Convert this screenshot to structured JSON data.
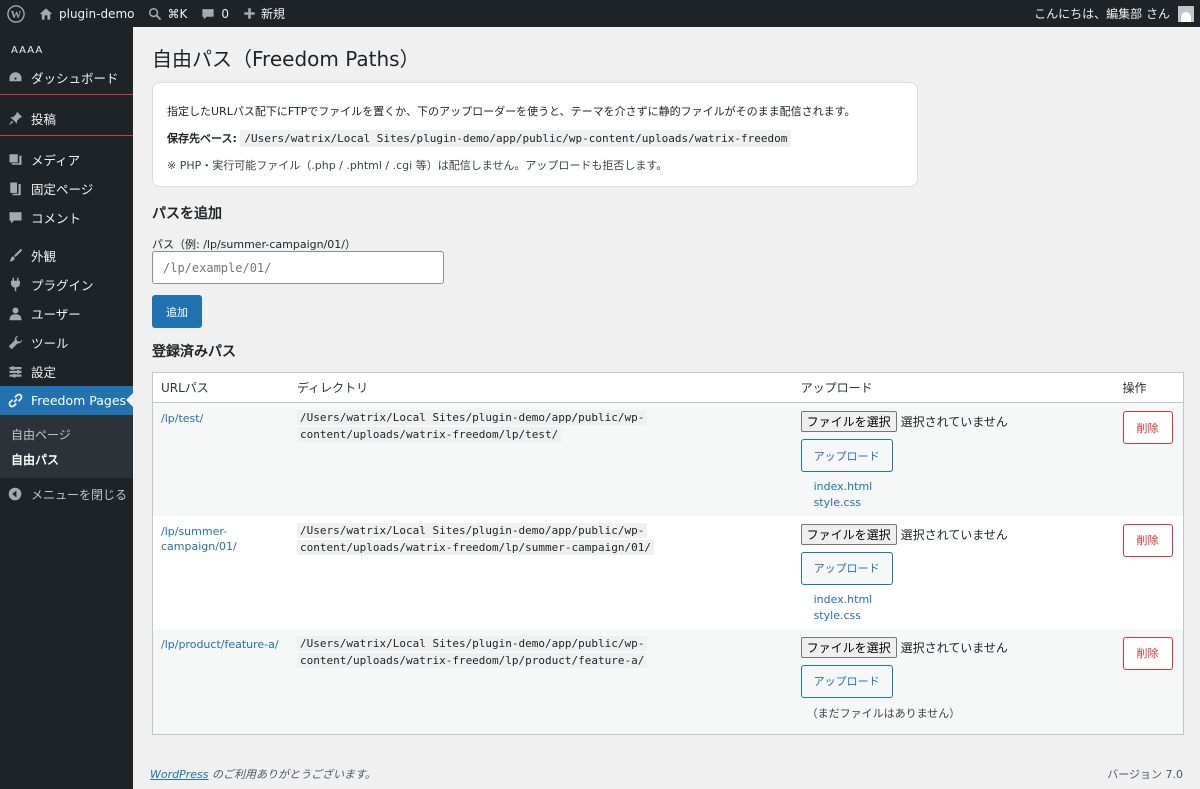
{
  "adminbar": {
    "site_name": "plugin-demo",
    "shortcut": "⌘K",
    "comments_count": "0",
    "new_label": "新規",
    "greeting": "こんにちは、編集部 さん"
  },
  "sidebar": {
    "site_title": "AAAA",
    "items": [
      {
        "label": "ダッシュボード",
        "icon": "dashboard-icon"
      },
      {
        "label": "投稿",
        "icon": "pin-icon"
      },
      {
        "label": "メディア",
        "icon": "media-icon"
      },
      {
        "label": "固定ページ",
        "icon": "page-icon"
      },
      {
        "label": "コメント",
        "icon": "comment-icon"
      },
      {
        "label": "外観",
        "icon": "brush-icon"
      },
      {
        "label": "プラグイン",
        "icon": "plugin-icon"
      },
      {
        "label": "ユーザー",
        "icon": "user-icon"
      },
      {
        "label": "ツール",
        "icon": "wrench-icon"
      },
      {
        "label": "設定",
        "icon": "settings-icon"
      },
      {
        "label": "Freedom Pages",
        "icon": "link-icon"
      }
    ],
    "submenu": [
      "自由ページ",
      "自由パス"
    ],
    "collapse_label": "メニューを閉じる"
  },
  "page": {
    "title": "自由パス（Freedom Paths）",
    "notice": {
      "description": "指定したURLパス配下にFTPでファイルを置くか、下のアップローダーを使うと、テーマを介さずに静的ファイルがそのまま配信されます。",
      "base_label": "保存先ベース:",
      "base_path": "/Users/watrix/Local Sites/plugin-demo/app/public/wp-content/uploads/watrix-freedom",
      "warning": "※ PHP・実行可能ファイル（.php / .phtml / .cgi 等）は配信しません。アップロードも拒否します。"
    },
    "add_section": {
      "heading": "パスを追加",
      "field_label": "パス（例: /lp/summer-campaign/01/）",
      "placeholder": "/lp/example/01/",
      "button": "追加"
    },
    "registered": {
      "heading": "登録済みパス",
      "columns": [
        "URLパス",
        "ディレクトリ",
        "アップロード",
        "操作"
      ],
      "file_button": "ファイルを選択",
      "file_status": "選択されていません",
      "upload_button": "アップロード",
      "delete_button": "削除",
      "rows": [
        {
          "url": "/lp/test/",
          "dir_line1": "/Users/watrix/Local Sites/plugin-demo/app/public/wp-",
          "dir_line2": "content/uploads/watrix-freedom/lp/test/",
          "files": [
            "index.html",
            "style.css"
          ],
          "empty": ""
        },
        {
          "url": "/lp/summer-campaign/01/",
          "dir_line1": "/Users/watrix/Local Sites/plugin-demo/app/public/wp-",
          "dir_line2": "content/uploads/watrix-freedom/lp/summer-campaign/01/",
          "files": [
            "index.html",
            "style.css"
          ],
          "empty": ""
        },
        {
          "url": "/lp/product/feature-a/",
          "dir_line1": "/Users/watrix/Local Sites/plugin-demo/app/public/wp-",
          "dir_line2": "content/uploads/watrix-freedom/lp/product/feature-a/",
          "files": [],
          "empty": "（まだファイルはありません）"
        }
      ]
    }
  },
  "footer": {
    "wp_link": "WordPress",
    "thanks": " のご利用ありがとうございます。",
    "version": "バージョン 7.0"
  }
}
